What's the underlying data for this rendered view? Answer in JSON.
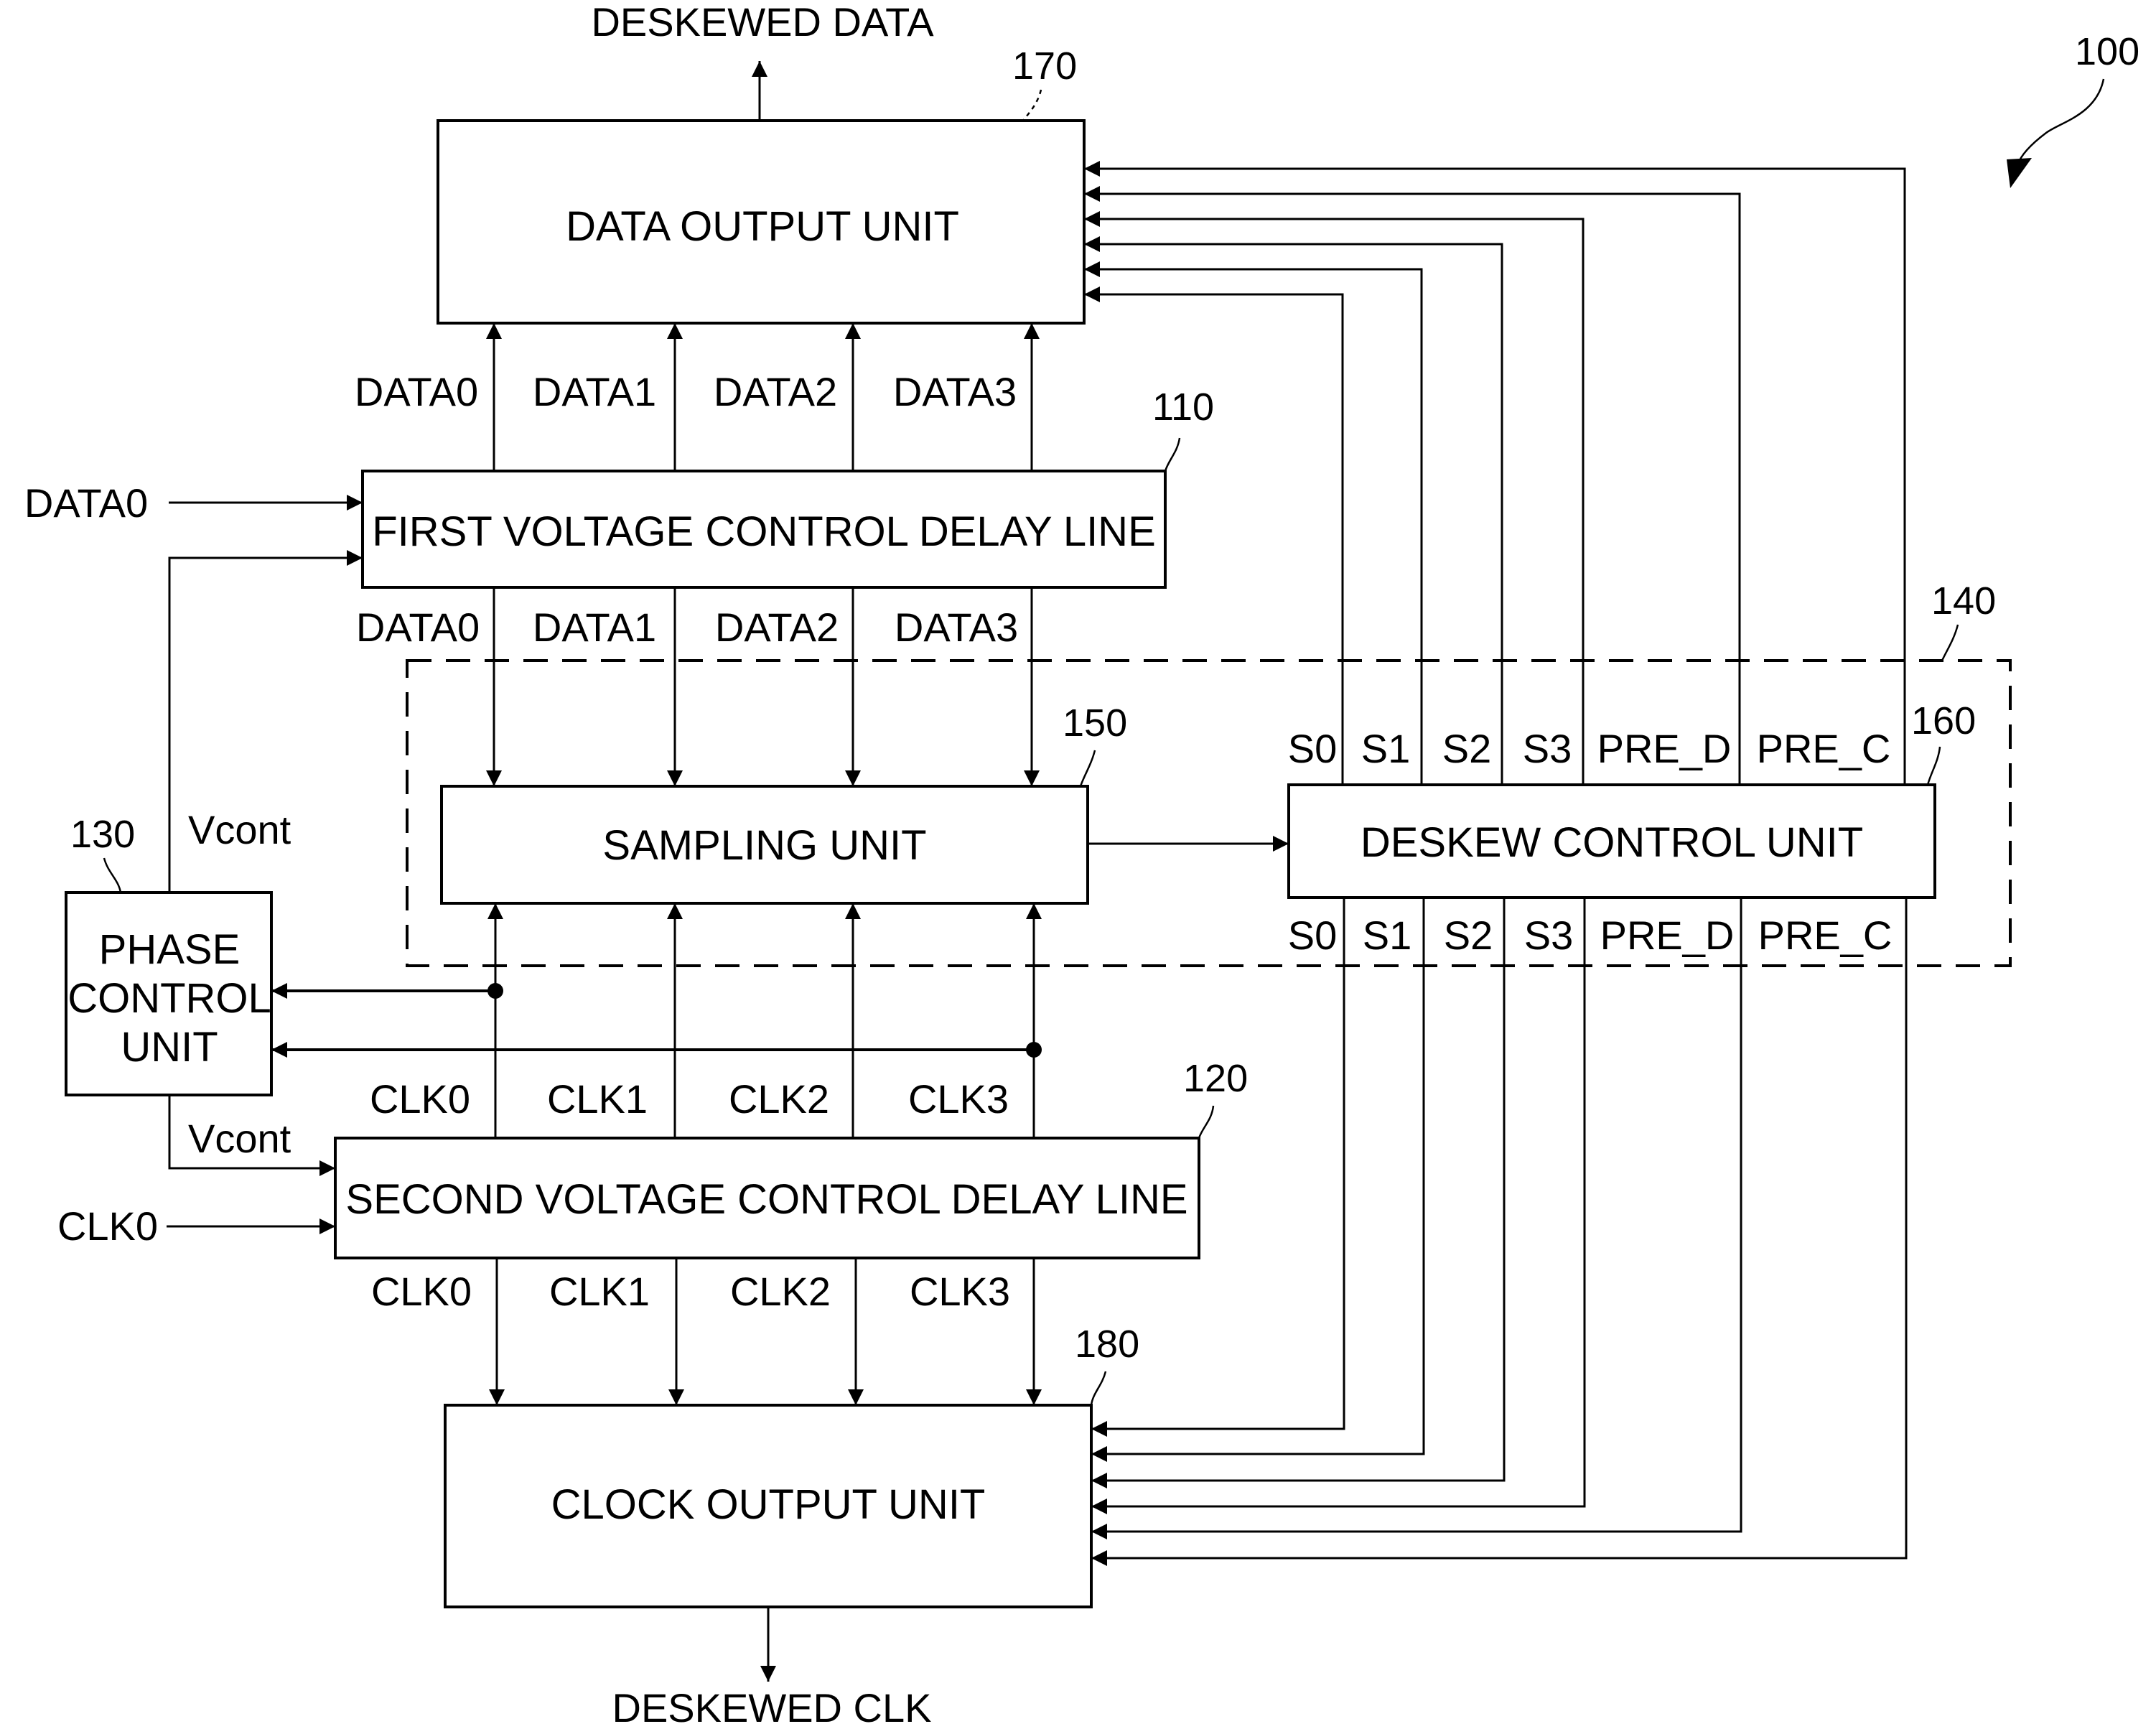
{
  "figure": {
    "ref": "100",
    "outputs": {
      "deskewed_data": "DESKEWED DATA",
      "deskewed_clk": "DESKEWED CLK"
    },
    "blocks": {
      "data_output_unit": {
        "label": "DATA OUTPUT UNIT",
        "ref": "170"
      },
      "first_vcdl": {
        "label": "FIRST VOLTAGE CONTROL DELAY LINE",
        "ref": "110"
      },
      "deskew_group": {
        "ref": "140"
      },
      "sampling_unit": {
        "label": "SAMPLING UNIT",
        "ref": "150"
      },
      "deskew_control_unit": {
        "label": "DESKEW CONTROL UNIT",
        "ref": "160"
      },
      "phase_control_unit": {
        "lines": [
          "PHASE",
          "CONTROL",
          "UNIT"
        ],
        "ref": "130"
      },
      "second_vcdl": {
        "label": "SECOND VOLTAGE CONTROL DELAY LINE",
        "ref": "120"
      },
      "clock_output_unit": {
        "label": "CLOCK OUTPUT UNIT",
        "ref": "180"
      }
    },
    "inputs": {
      "data_in": "DATA0",
      "clk_in": "CLK0"
    },
    "vcont_top": "Vcont",
    "vcont_bottom": "Vcont",
    "data_signals_upper": [
      "DATA0",
      "DATA1",
      "DATA2",
      "DATA3"
    ],
    "data_signals_lower": [
      "DATA0",
      "DATA1",
      "DATA2",
      "DATA3"
    ],
    "clk_signals_upper": [
      "CLK0",
      "CLK1",
      "CLK2",
      "CLK3"
    ],
    "clk_signals_lower": [
      "CLK0",
      "CLK1",
      "CLK2",
      "CLK3"
    ],
    "control_signals_top": [
      "S0",
      "S1",
      "S2",
      "S3",
      "PRE_D",
      "PRE_C"
    ],
    "control_signals_bottom": [
      "S0",
      "S1",
      "S2",
      "S3",
      "PRE_D",
      "PRE_C"
    ]
  }
}
